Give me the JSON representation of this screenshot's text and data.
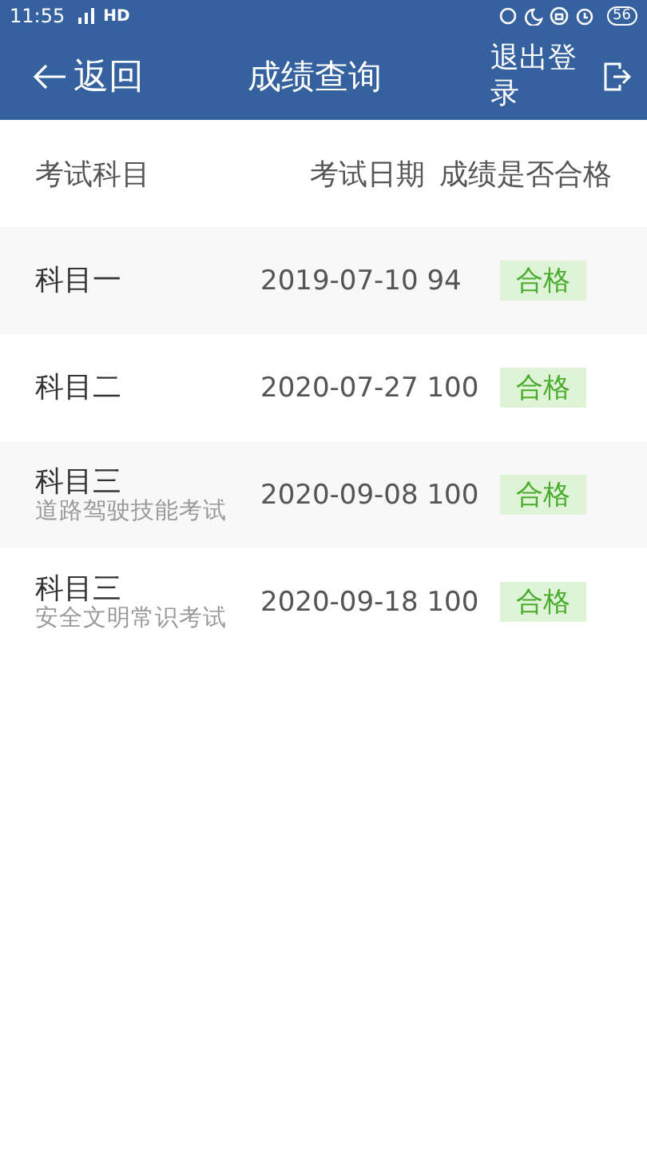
{
  "status_bar": {
    "time": "11:55",
    "network": "HD",
    "battery": "56"
  },
  "nav": {
    "back": "返回",
    "title": "成绩查询",
    "logout": "退出登录"
  },
  "table": {
    "columns": [
      "考试科目",
      "考试日期",
      "成绩是否合格"
    ],
    "rows": [
      {
        "subject": "科目一",
        "date": "2019-07-10",
        "score": "94",
        "result": "合格"
      },
      {
        "subject": "科目二",
        "date": "2020-07-27",
        "score": "100",
        "result": "合格"
      },
      {
        "subject": "科目三",
        "subtitle": "道路驾驶技能考试",
        "date": "2020-09-08",
        "score": "100",
        "result": "合格"
      },
      {
        "subject": "科目三",
        "subtitle": "安全文明常识考试",
        "date": "2020-09-18",
        "score": "100",
        "result": "合格"
      }
    ]
  }
}
